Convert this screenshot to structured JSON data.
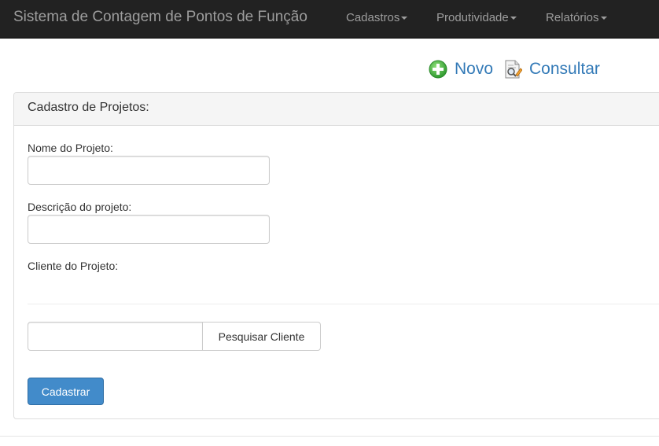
{
  "navbar": {
    "brand": "Sistema de Contagem de Pontos de Função",
    "menus": [
      {
        "label": "Cadastros"
      },
      {
        "label": "Produtividade"
      },
      {
        "label": "Relatórios"
      }
    ]
  },
  "actions": {
    "new_label": "Novo",
    "search_label": "Consultar",
    "new_icon": "plus-circle-icon",
    "search_icon": "document-search-icon",
    "new_icon_color": "#4cae4c",
    "link_color": "#337ab7"
  },
  "panel": {
    "title": "Cadastro de Projetos:"
  },
  "form": {
    "project_name_label": "Nome do Projeto:",
    "project_name_value": "",
    "project_description_label": "Descrição do projeto:",
    "project_description_value": "",
    "client_label": "Cliente do Projeto:",
    "client_search_value": "",
    "client_search_button": "Pesquisar Cliente",
    "submit_button": "Cadastrar"
  },
  "colors": {
    "navbar_bg": "#222222",
    "navbar_text": "#9d9d9d",
    "primary_button": "#428bca",
    "panel_heading_bg": "#f5f5f5"
  }
}
